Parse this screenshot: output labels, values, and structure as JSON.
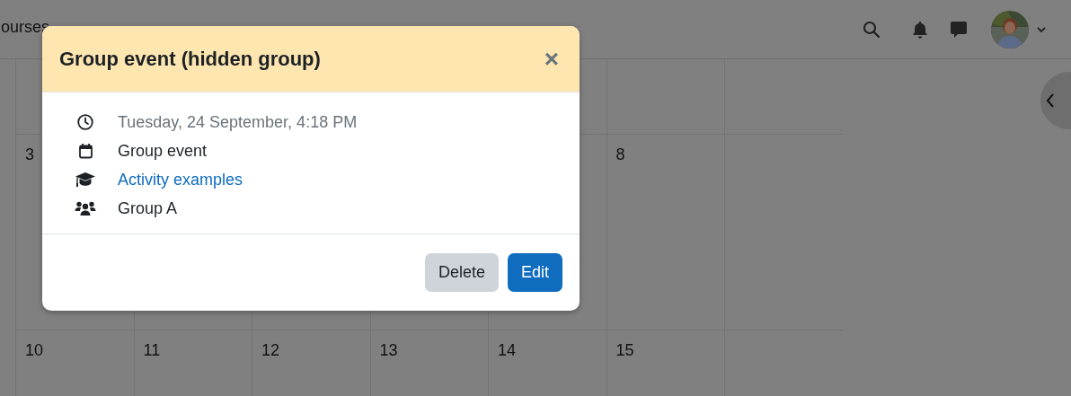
{
  "navbar": {
    "items": [
      {
        "label": "ourses"
      }
    ]
  },
  "calendar": {
    "partial_row": {
      "start_day": "3",
      "end_day": "8"
    },
    "rows": [
      {
        "days": [
          "10",
          "11",
          "12",
          "13",
          "14",
          "15"
        ]
      }
    ]
  },
  "modal": {
    "title": "Group event (hidden group)",
    "close": "×",
    "details": [
      {
        "kind": "time",
        "text": "Tuesday, 24 September, 4:18 PM"
      },
      {
        "kind": "type",
        "text": "Group event"
      },
      {
        "kind": "course",
        "text": "Activity examples"
      },
      {
        "kind": "group",
        "text": "Group A"
      }
    ],
    "buttons": [
      {
        "label": "Delete",
        "kind": "secondary"
      },
      {
        "label": "Edit",
        "kind": "primary"
      }
    ]
  }
}
